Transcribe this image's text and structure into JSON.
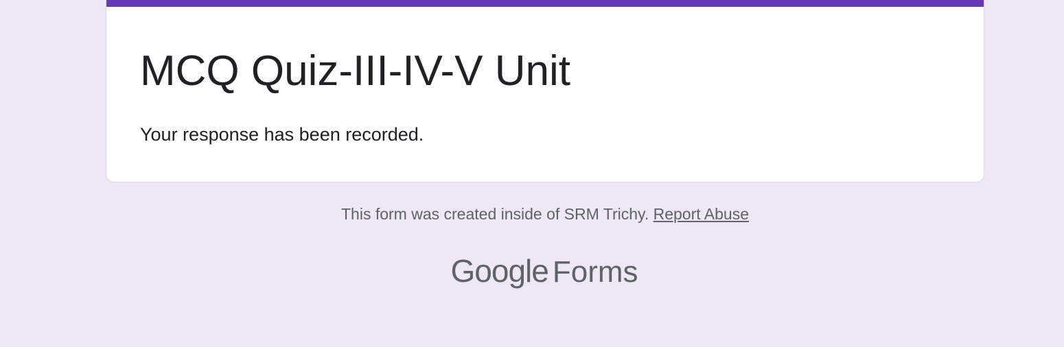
{
  "form": {
    "title": "MCQ Quiz-III-IV-V Unit",
    "confirmation_message": "Your response has been recorded."
  },
  "footer": {
    "created_inside_text": "This form was created inside of SRM Trichy.",
    "report_abuse_label": "Report Abuse"
  },
  "brand": {
    "google_text": "Google",
    "forms_text": "Forms"
  },
  "colors": {
    "page_background": "#ede7f6",
    "accent": "#673ab7",
    "card_background": "#ffffff",
    "title_text": "#202124",
    "muted_text": "#5f6368"
  }
}
